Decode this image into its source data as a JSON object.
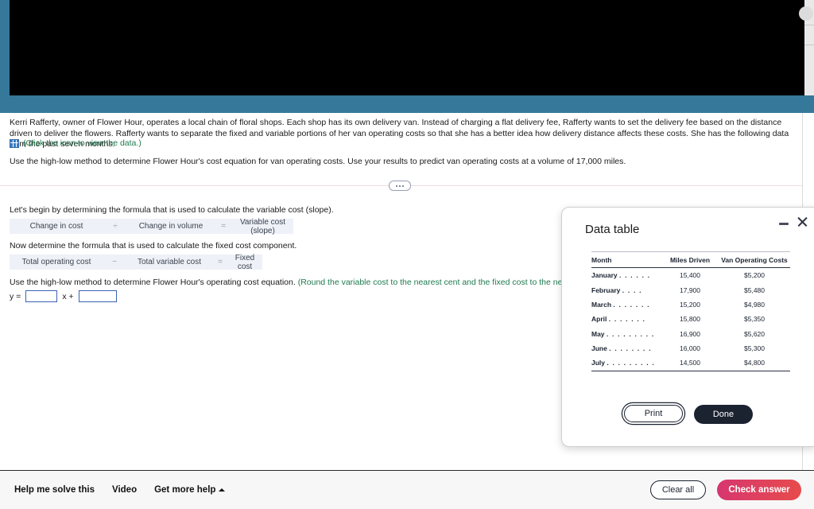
{
  "problem": {
    "paragraph": "Kerri Rafferty, owner of Flower Hour, operates a local chain of floral shops. Each shop has its own delivery van. Instead of charging a flat delivery fee, Rafferty wants to set the delivery fee based on the distance driven to deliver the flowers. Rafferty wants to separate the fixed and variable portions of her van operating costs so that she has a better idea how delivery distance affects these costs. She has the following data from the past seven months:",
    "data_link_text": "(Click the icon to view the data.)",
    "data_link_icon": "grid-table-icon",
    "instruction": "Use the high-low method to determine Flower Hour's cost equation for van operating costs. Use your results to predict van operating costs at a volume of 17,000 miles."
  },
  "worksheet": {
    "step1_prompt": "Let's begin by determining the formula that is used to calculate the variable cost (slope).",
    "formula1": {
      "term1": "Change in cost",
      "op1": "÷",
      "term2": "Change in volume",
      "op2": "=",
      "result": "Variable cost (slope)"
    },
    "step2_prompt": "Now determine the formula that is used to calculate the fixed cost component.",
    "formula2": {
      "term1": "Total operating cost",
      "op1": "−",
      "term2": "Total variable cost",
      "op2": "=",
      "result": "Fixed cost"
    },
    "step3_prompt": "Use the high-low method to determine Flower Hour's operating cost equation.",
    "step3_hint": "(Round the variable cost to the nearest cent and the fixed cost to the nearest whole dollar.)",
    "equation": {
      "y_label": "y =",
      "slope_value": "",
      "x_plus": "x +",
      "intercept_value": ""
    }
  },
  "divider": {
    "ellipsis": "..."
  },
  "dialog": {
    "title": "Data table",
    "minimize_icon": "minimize-icon",
    "close_icon": "close-icon",
    "table": {
      "headers": [
        "Month",
        "Miles Driven",
        "Van Operating Costs"
      ],
      "rows": [
        {
          "month": "January",
          "dots": ". . . . . .",
          "miles": "15,400",
          "cost": "$5,200"
        },
        {
          "month": "February",
          "dots": ". . . .",
          "miles": "17,900",
          "cost": "$5,480"
        },
        {
          "month": "March",
          "dots": ". . . . . . .",
          "miles": "15,200",
          "cost": "$4,980"
        },
        {
          "month": "April",
          "dots": ". . . . . . .",
          "miles": "15,800",
          "cost": "$5,350"
        },
        {
          "month": "May",
          "dots": ". . . . . . . . .",
          "miles": "16,900",
          "cost": "$5,620"
        },
        {
          "month": "June",
          "dots": ". . . . . . . .",
          "miles": "16,000",
          "cost": "$5,300"
        },
        {
          "month": "July",
          "dots": ". . . . . . . . .",
          "miles": "14,500",
          "cost": "$4,800"
        }
      ]
    },
    "print_label": "Print",
    "done_label": "Done"
  },
  "bottom_bar": {
    "help_label": "Help me solve this",
    "video_label": "Video",
    "more_help_label": "Get more help",
    "more_help_caret": "caret-up-icon",
    "clear_label": "Clear all",
    "check_label": "Check answer"
  },
  "colors": {
    "banner_teal": "#35789a",
    "link_green": "#1f7a4d",
    "input_border_blue": "#3b62b5",
    "check_answer_start": "#d6366f",
    "check_answer_end": "#e64b4b",
    "dialog_dark": "#1b2230"
  }
}
